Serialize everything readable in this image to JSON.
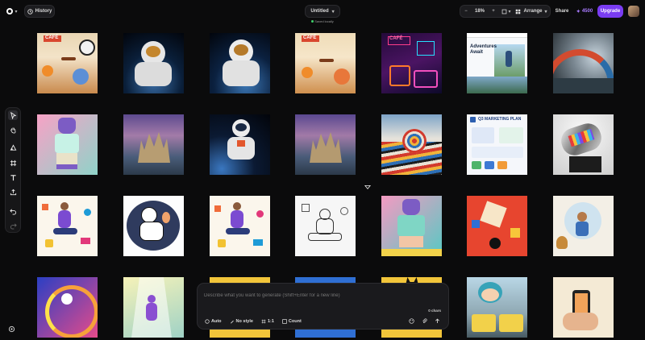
{
  "header": {
    "history_label": "History",
    "doc_title": "Untitled",
    "saved_status": "Saved locally",
    "zoom_level": "18%",
    "zoom_out_symbol": "−",
    "zoom_in_symbol": "+",
    "arrange_label": "Arrange",
    "share_label": "Share",
    "credits_value": "4500",
    "upgrade_label": "Upgrade"
  },
  "toolbar": {
    "tools": [
      "select-tool",
      "hand-tool",
      "shapes-tool",
      "frame-tool",
      "text-tool",
      "upload-tool",
      "undo",
      "redo"
    ]
  },
  "canvas": {
    "tiles": [
      {
        "name": "cafe-illustration",
        "caption": "CAFÉ"
      },
      {
        "name": "astronaut-earth",
        "caption": ""
      },
      {
        "name": "astronaut-earth-variant",
        "caption": ""
      },
      {
        "name": "cafe-illustration-variant",
        "caption": "CAFÉ"
      },
      {
        "name": "neon-cafe",
        "caption": "CAFÉ"
      },
      {
        "name": "adventures-await-webpage",
        "caption": "Adventures Await"
      },
      {
        "name": "surreal-wave",
        "caption": ""
      },
      {
        "name": "cat-character",
        "caption": ""
      },
      {
        "name": "fantasy-castle",
        "caption": ""
      },
      {
        "name": "astronaut-space",
        "caption": ""
      },
      {
        "name": "fantasy-castle-variant",
        "caption": ""
      },
      {
        "name": "striped-wave",
        "caption": ""
      },
      {
        "name": "q3-marketing-plan",
        "caption": "Q3 MARKETING PLAN"
      },
      {
        "name": "chrome-sculpture",
        "caption": ""
      },
      {
        "name": "floating-person-objects",
        "caption": ""
      },
      {
        "name": "astronaut-line-art",
        "caption": ""
      },
      {
        "name": "floating-person-objects-variant",
        "caption": ""
      },
      {
        "name": "meditation-sketch",
        "caption": ""
      },
      {
        "name": "cat-character-teal",
        "caption": ""
      },
      {
        "name": "red-collage",
        "caption": ""
      },
      {
        "name": "juggler-illustration",
        "caption": ""
      },
      {
        "name": "surreal-collage",
        "caption": ""
      },
      {
        "name": "dancer-spotlight",
        "caption": ""
      },
      {
        "name": "yellow-partial-tile",
        "caption": ""
      },
      {
        "name": "blue-partial-tile",
        "caption": ""
      },
      {
        "name": "yellow-cat-partial-tile",
        "caption": ""
      },
      {
        "name": "city-tram-illustration",
        "caption": ""
      },
      {
        "name": "phone-hand-illustration",
        "caption": ""
      }
    ]
  },
  "prompt": {
    "placeholder": "Describe what you want to generate (Shift+Enter for a new line)",
    "char_count": "0 chars",
    "options": [
      {
        "label": "Auto",
        "icon": "auto-icon"
      },
      {
        "label": "No style",
        "icon": "style-icon"
      },
      {
        "label": "1:1",
        "icon": "aspect-ratio-icon"
      },
      {
        "label": "Count",
        "icon": "count-icon"
      }
    ]
  },
  "colors": {
    "background": "#0b0b0c",
    "accent": "#7a3cf2",
    "credits": "#a97bff",
    "saved_dot": "#3fcf6b"
  }
}
